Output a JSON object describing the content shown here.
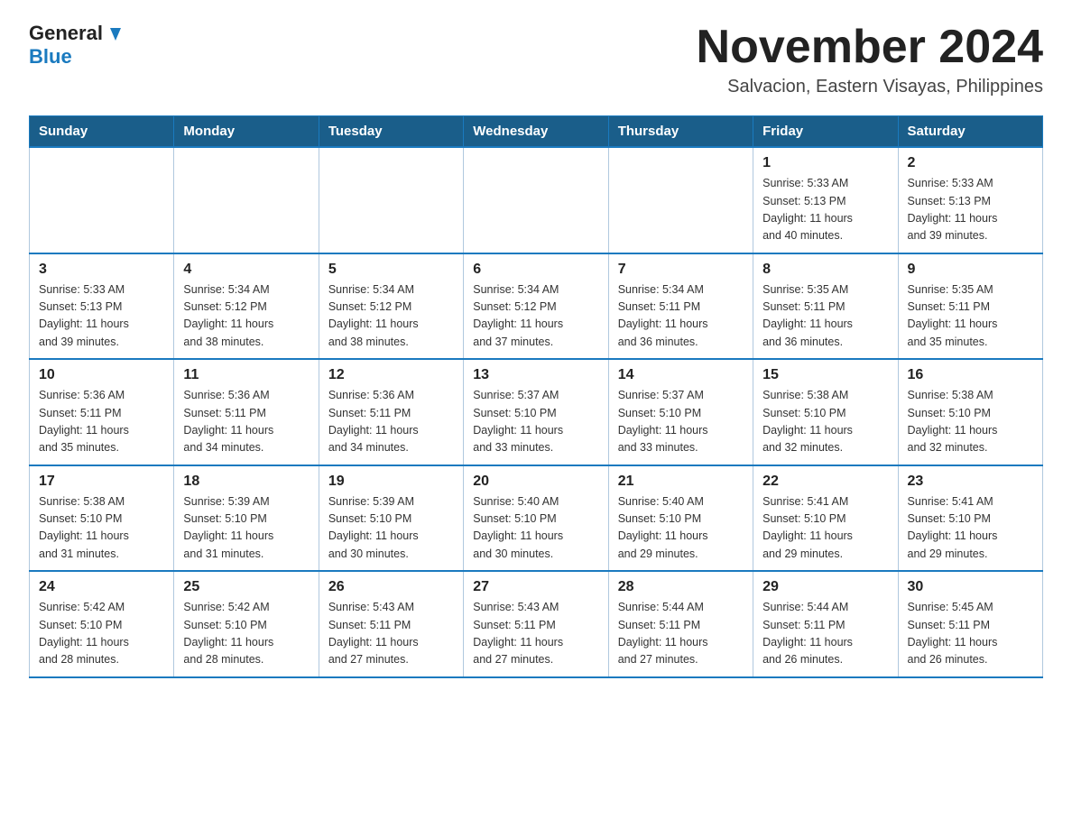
{
  "logo": {
    "general": "General",
    "blue": "Blue"
  },
  "header": {
    "month_year": "November 2024",
    "location": "Salvacion, Eastern Visayas, Philippines"
  },
  "days_of_week": [
    "Sunday",
    "Monday",
    "Tuesday",
    "Wednesday",
    "Thursday",
    "Friday",
    "Saturday"
  ],
  "weeks": [
    [
      {
        "day": "",
        "info": ""
      },
      {
        "day": "",
        "info": ""
      },
      {
        "day": "",
        "info": ""
      },
      {
        "day": "",
        "info": ""
      },
      {
        "day": "",
        "info": ""
      },
      {
        "day": "1",
        "info": "Sunrise: 5:33 AM\nSunset: 5:13 PM\nDaylight: 11 hours\nand 40 minutes."
      },
      {
        "day": "2",
        "info": "Sunrise: 5:33 AM\nSunset: 5:13 PM\nDaylight: 11 hours\nand 39 minutes."
      }
    ],
    [
      {
        "day": "3",
        "info": "Sunrise: 5:33 AM\nSunset: 5:13 PM\nDaylight: 11 hours\nand 39 minutes."
      },
      {
        "day": "4",
        "info": "Sunrise: 5:34 AM\nSunset: 5:12 PM\nDaylight: 11 hours\nand 38 minutes."
      },
      {
        "day": "5",
        "info": "Sunrise: 5:34 AM\nSunset: 5:12 PM\nDaylight: 11 hours\nand 38 minutes."
      },
      {
        "day": "6",
        "info": "Sunrise: 5:34 AM\nSunset: 5:12 PM\nDaylight: 11 hours\nand 37 minutes."
      },
      {
        "day": "7",
        "info": "Sunrise: 5:34 AM\nSunset: 5:11 PM\nDaylight: 11 hours\nand 36 minutes."
      },
      {
        "day": "8",
        "info": "Sunrise: 5:35 AM\nSunset: 5:11 PM\nDaylight: 11 hours\nand 36 minutes."
      },
      {
        "day": "9",
        "info": "Sunrise: 5:35 AM\nSunset: 5:11 PM\nDaylight: 11 hours\nand 35 minutes."
      }
    ],
    [
      {
        "day": "10",
        "info": "Sunrise: 5:36 AM\nSunset: 5:11 PM\nDaylight: 11 hours\nand 35 minutes."
      },
      {
        "day": "11",
        "info": "Sunrise: 5:36 AM\nSunset: 5:11 PM\nDaylight: 11 hours\nand 34 minutes."
      },
      {
        "day": "12",
        "info": "Sunrise: 5:36 AM\nSunset: 5:11 PM\nDaylight: 11 hours\nand 34 minutes."
      },
      {
        "day": "13",
        "info": "Sunrise: 5:37 AM\nSunset: 5:10 PM\nDaylight: 11 hours\nand 33 minutes."
      },
      {
        "day": "14",
        "info": "Sunrise: 5:37 AM\nSunset: 5:10 PM\nDaylight: 11 hours\nand 33 minutes."
      },
      {
        "day": "15",
        "info": "Sunrise: 5:38 AM\nSunset: 5:10 PM\nDaylight: 11 hours\nand 32 minutes."
      },
      {
        "day": "16",
        "info": "Sunrise: 5:38 AM\nSunset: 5:10 PM\nDaylight: 11 hours\nand 32 minutes."
      }
    ],
    [
      {
        "day": "17",
        "info": "Sunrise: 5:38 AM\nSunset: 5:10 PM\nDaylight: 11 hours\nand 31 minutes."
      },
      {
        "day": "18",
        "info": "Sunrise: 5:39 AM\nSunset: 5:10 PM\nDaylight: 11 hours\nand 31 minutes."
      },
      {
        "day": "19",
        "info": "Sunrise: 5:39 AM\nSunset: 5:10 PM\nDaylight: 11 hours\nand 30 minutes."
      },
      {
        "day": "20",
        "info": "Sunrise: 5:40 AM\nSunset: 5:10 PM\nDaylight: 11 hours\nand 30 minutes."
      },
      {
        "day": "21",
        "info": "Sunrise: 5:40 AM\nSunset: 5:10 PM\nDaylight: 11 hours\nand 29 minutes."
      },
      {
        "day": "22",
        "info": "Sunrise: 5:41 AM\nSunset: 5:10 PM\nDaylight: 11 hours\nand 29 minutes."
      },
      {
        "day": "23",
        "info": "Sunrise: 5:41 AM\nSunset: 5:10 PM\nDaylight: 11 hours\nand 29 minutes."
      }
    ],
    [
      {
        "day": "24",
        "info": "Sunrise: 5:42 AM\nSunset: 5:10 PM\nDaylight: 11 hours\nand 28 minutes."
      },
      {
        "day": "25",
        "info": "Sunrise: 5:42 AM\nSunset: 5:10 PM\nDaylight: 11 hours\nand 28 minutes."
      },
      {
        "day": "26",
        "info": "Sunrise: 5:43 AM\nSunset: 5:11 PM\nDaylight: 11 hours\nand 27 minutes."
      },
      {
        "day": "27",
        "info": "Sunrise: 5:43 AM\nSunset: 5:11 PM\nDaylight: 11 hours\nand 27 minutes."
      },
      {
        "day": "28",
        "info": "Sunrise: 5:44 AM\nSunset: 5:11 PM\nDaylight: 11 hours\nand 27 minutes."
      },
      {
        "day": "29",
        "info": "Sunrise: 5:44 AM\nSunset: 5:11 PM\nDaylight: 11 hours\nand 26 minutes."
      },
      {
        "day": "30",
        "info": "Sunrise: 5:45 AM\nSunset: 5:11 PM\nDaylight: 11 hours\nand 26 minutes."
      }
    ]
  ]
}
